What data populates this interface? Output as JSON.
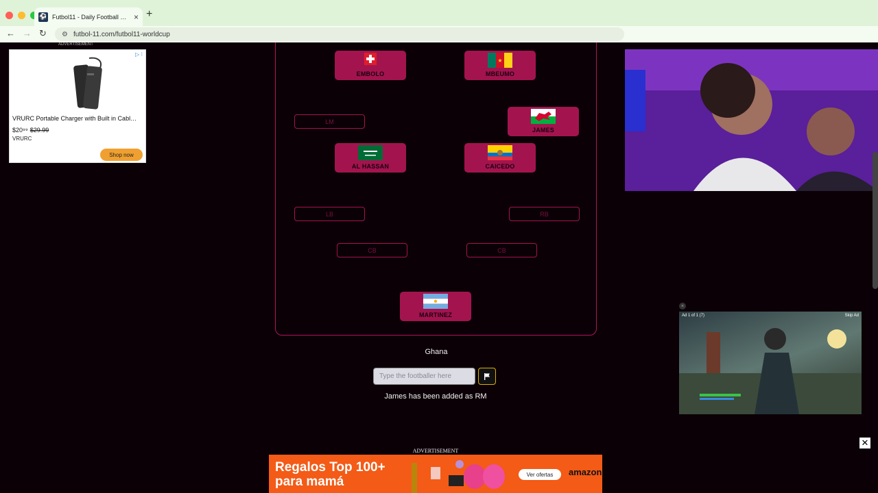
{
  "browser": {
    "tab_title": "Futbol11 - Daily Football Gam…",
    "url": "futbol-11.com/futbol11-worldcup",
    "new_tab_symbol": "+",
    "tab_close_symbol": "×"
  },
  "left_ad": {
    "label": "ADVERTISEMENT",
    "title": "VRURC Portable Charger with Built in Cabl…",
    "price": "$20⁹⁹",
    "old_price": "$29.99",
    "brand": "VRURC",
    "button": "Shop now"
  },
  "players": [
    {
      "name": "EMBOLO",
      "flag": "switzerland"
    },
    {
      "name": "MBEUMO",
      "flag": "cameroon"
    },
    {
      "name": "JAMES",
      "flag": "wales"
    },
    {
      "name": "AL HASSAN",
      "flag": "saudi-arabia"
    },
    {
      "name": "CAICEDO",
      "flag": "ecuador"
    },
    {
      "name": "MARTINEZ",
      "flag": "argentina"
    }
  ],
  "empty_slots": [
    "LM",
    "LB",
    "RB",
    "CB",
    "CB"
  ],
  "country": "Ghana",
  "input_placeholder": "Type the footballer here",
  "status": "James has been added as RM",
  "video_ad": {
    "counter": "Ad 1 of 1 (7)",
    "skip": "Skip Ad"
  },
  "bottom_ad": {
    "label": "ADVERTISEMENT",
    "line1": "Regalos Top 100+",
    "line2": "para mamá",
    "button": "Ver ofertas",
    "brand": "amazon"
  },
  "colors": {
    "player_bg": "#a3144e",
    "page_bg": "#0b0006",
    "ad_orange": "#f35b17"
  }
}
